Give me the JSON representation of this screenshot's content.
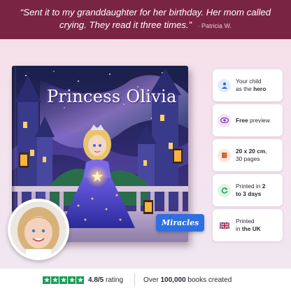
{
  "testimonial": {
    "quote": "“Sent it to my granddaughter for her birthday. Her mom called crying. They read it three times.”",
    "author": "Patricia W."
  },
  "book": {
    "title": "Princess Olivia",
    "badge": "Miracles"
  },
  "features": [
    {
      "icon": "person-icon",
      "pre": "Your child",
      "mid": "as the ",
      "bold": "hero",
      "color": "#3a6fd8",
      "bg": "#e3ecfb"
    },
    {
      "icon": "eye-icon",
      "pre": "",
      "mid": "",
      "bold": "Free",
      "post": " preview",
      "color": "#8a2fb0",
      "bg": "#f1e2f6"
    },
    {
      "icon": "book-icon",
      "bold": "20 x 20 cm",
      "post": ",",
      "line2": "30 pages",
      "color": "#e8632a",
      "bg": "#fde8dd"
    },
    {
      "icon": "refresh-icon",
      "pre": "Printed in ",
      "bold": "2",
      "line2bold": "to 3 days",
      "color": "#1e9e5a",
      "bg": "#dff3e8"
    },
    {
      "icon": "uk-flag-icon",
      "pre": "Printed",
      "line2pre": "in ",
      "line2bold": "the UK",
      "color": "#c8102e",
      "bg": "#ffffff"
    }
  ],
  "rating": {
    "score": "4.8/5",
    "suffix": " rating",
    "books_prefix": "Over ",
    "books_bold": "100,000",
    "books_suffix": " books created"
  }
}
